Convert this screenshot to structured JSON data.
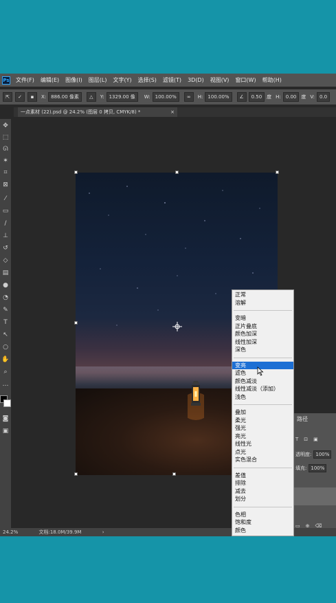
{
  "app": {
    "logo": "Ps"
  },
  "menu": [
    "文件(F)",
    "编辑(E)",
    "图像(I)",
    "图层(L)",
    "文字(Y)",
    "选择(S)",
    "滤镜(T)",
    "3D(D)",
    "视图(V)",
    "窗口(W)",
    "帮助(H)"
  ],
  "options": {
    "x_label": "X:",
    "x_value": "886.00 像素",
    "y_label": "Y:",
    "y_value": "1329.00 像",
    "w_label": "W:",
    "w_value": "100.00%",
    "h_label": "H:",
    "h_value": "100.00%",
    "angle_value": "0.50",
    "angle_unit": "度",
    "hskew_label": "H:",
    "hskew_value": "0.00",
    "hskew_unit": "度",
    "v_label": "V:",
    "v_value": "0.0"
  },
  "tab": {
    "title": "一点素材 (22).psd @ 24.2% (图层 0 拷贝, CMYK/8) *",
    "close": "×"
  },
  "blend_groups": [
    [
      "正常",
      "溶解"
    ],
    [
      "变暗",
      "正片叠底",
      "颜色加深",
      "线性加深",
      "深色"
    ],
    [
      "变亮",
      "滤色",
      "颜色减淡",
      "线性减淡（添加）",
      "浅色"
    ],
    [
      "叠加",
      "柔光",
      "强光",
      "亮光",
      "线性光",
      "点光",
      "实色混合"
    ],
    [
      "差值",
      "排除",
      "减去",
      "划分"
    ],
    [
      "色相",
      "饱和度",
      "颜色"
    ]
  ],
  "blend_selected": "变亮",
  "panel": {
    "tab": "路径",
    "opacity_label": "透明度:",
    "opacity_value": "100%",
    "fill_label": "填充:",
    "fill_value": "100%"
  },
  "status": {
    "zoom": "24.2%",
    "doc": "文档:18.0M/39.9M",
    "arrow": "›"
  },
  "colors": {
    "accent": "#1d6fd4",
    "frame": "#1594a8",
    "ui_dark": "#282828",
    "ui_mid": "#535353"
  }
}
